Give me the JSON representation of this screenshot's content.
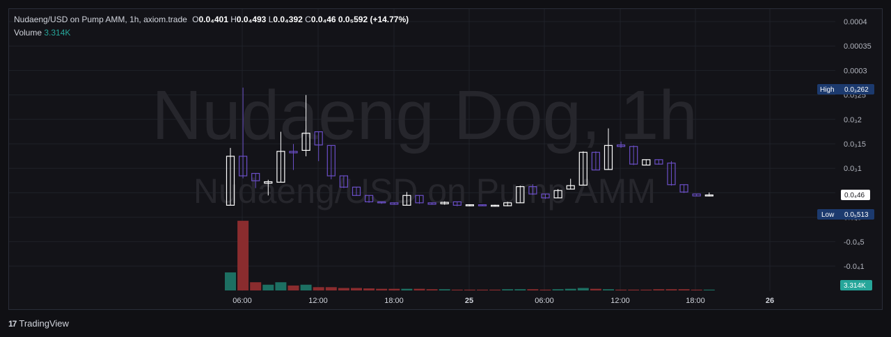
{
  "legend": {
    "pair": "Nudaeng/USD on Pump AMM, 1h, axiom.trade",
    "o_label": "O",
    "o_value": "0.0₄401",
    "h_label": "H",
    "h_value": "0.0₄493",
    "l_label": "L",
    "l_value": "0.0₄392",
    "c_label": "C",
    "c_value": "0.0₄46",
    "change": "0.0₅592 (+14.77%)"
  },
  "volume_legend": {
    "label": "Volume",
    "value": "3.314K"
  },
  "watermark": {
    "line1": "Nudaeng Dog, 1h",
    "line2": "Nudaeng/USD on Pump AMM"
  },
  "price_axis_labels": [
    "0.0004",
    "0.00035",
    "0.0003",
    "0.0₃25",
    "0.0₃2",
    "0.0₃15",
    "0.0₃1",
    "0.0₄5",
    "0.0₄5",
    "-0.0₄5",
    "-0.0₄1"
  ],
  "time_axis_labels": [
    "06:00",
    "12:00",
    "18:00",
    "25",
    "06:00",
    "12:00",
    "18:00",
    "26"
  ],
  "price_markers": {
    "high_label": "High",
    "high_value": "0.0₃262",
    "current_value": "0.0₄46",
    "low_label": "Low",
    "low_value": "0.0₅513"
  },
  "volume_marker": "3.314K",
  "footer": {
    "brand": "TradingView",
    "logo": "17"
  },
  "colors": {
    "background": "#131318",
    "grid": "#1f2229",
    "bull": "#ffffff",
    "bear": "#6b4fc8",
    "vol_up": "#1d6f62",
    "vol_down": "#8a2c2e",
    "high_badge": "#1c3a6e",
    "watermark": "#2a2a30"
  },
  "chart_data": {
    "type": "candlestick",
    "price_axis": {
      "min": -1.3e-05,
      "max": 4e-05,
      "unit": "USD"
    },
    "x_axis_ticks": [
      "06:00",
      "12:00",
      "18:00",
      "25",
      "06:00",
      "12:00",
      "18:00",
      "26"
    ],
    "candles": [
      {
        "o": 2.5e-06,
        "h": 1.42e-05,
        "l": 2.5e-06,
        "c": 1.25e-05
      },
      {
        "o": 1.25e-05,
        "h": 2.65e-05,
        "l": 8e-06,
        "c": 8.5e-06
      },
      {
        "o": 9e-06,
        "h": 9e-06,
        "l": 6e-06,
        "c": 7.5e-06
      },
      {
        "o": 7e-06,
        "h": 7.7e-06,
        "l": 4.5e-06,
        "c": 7.3e-06
      },
      {
        "o": 7.2e-06,
        "h": 1.75e-05,
        "l": 7.2e-06,
        "c": 1.35e-05
      },
      {
        "o": 1.35e-05,
        "h": 1.5e-05,
        "l": 9.7e-06,
        "c": 1.32e-05
      },
      {
        "o": 1.37e-05,
        "h": 2.5e-05,
        "l": 1.25e-05,
        "c": 1.72e-05
      },
      {
        "o": 1.75e-05,
        "h": 1.75e-05,
        "l": 1.15e-05,
        "c": 1.48e-05
      },
      {
        "o": 1.47e-05,
        "h": 1.47e-05,
        "l": 7.8e-06,
        "c": 8.5e-06
      },
      {
        "o": 8.5e-06,
        "h": 8.5e-06,
        "l": 6e-06,
        "c": 6.2e-06
      },
      {
        "o": 6.2e-06,
        "h": 6.2e-06,
        "l": 4.4e-06,
        "c": 4.5e-06
      },
      {
        "o": 4.5e-06,
        "h": 4.5e-06,
        "l": 3e-06,
        "c": 3.2e-06
      },
      {
        "o": 3.2e-06,
        "h": 3.2e-06,
        "l": 2.8e-06,
        "c": 3e-06
      },
      {
        "o": 3e-06,
        "h": 3e-06,
        "l": 2.6e-06,
        "c": 2.7e-06
      },
      {
        "o": 2.5e-06,
        "h": 5.2e-06,
        "l": 2.5e-06,
        "c": 4.5e-06
      },
      {
        "o": 4.5e-06,
        "h": 4.5e-06,
        "l": 2.8e-06,
        "c": 3e-06
      },
      {
        "o": 3e-06,
        "h": 3e-06,
        "l": 2.6e-06,
        "c": 2.7e-06
      },
      {
        "o": 2.8e-06,
        "h": 3.3e-06,
        "l": 2.6e-06,
        "c": 3.1e-06
      },
      {
        "o": 3.2e-06,
        "h": 3.2e-06,
        "l": 2.3e-06,
        "c": 2.5e-06
      },
      {
        "o": 2.5e-06,
        "h": 2.7e-06,
        "l": 2.3e-06,
        "c": 2.6e-06
      },
      {
        "o": 2.6e-06,
        "h": 2.6e-06,
        "l": 2.4e-06,
        "c": 2.5e-06
      },
      {
        "o": 2.5e-06,
        "h": 2.6e-06,
        "l": 2.3e-06,
        "c": 2.5e-06
      },
      {
        "o": 2.4e-06,
        "h": 3.2e-06,
        "l": 2.3e-06,
        "c": 3e-06
      },
      {
        "o": 3e-06,
        "h": 6.5e-06,
        "l": 3e-06,
        "c": 6.3e-06
      },
      {
        "o": 6.3e-06,
        "h": 6.8e-06,
        "l": 4.6e-06,
        "c": 4.8e-06
      },
      {
        "o": 4.8e-06,
        "h": 4.8e-06,
        "l": 3.8e-06,
        "c": 4e-06
      },
      {
        "o": 4e-06,
        "h": 5.8e-06,
        "l": 4e-06,
        "c": 5.5e-06
      },
      {
        "o": 5.8e-06,
        "h": 7.9e-06,
        "l": 5.8e-06,
        "c": 6.5e-06
      },
      {
        "o": 6.6e-06,
        "h": 1.35e-05,
        "l": 6.6e-06,
        "c": 1.33e-05
      },
      {
        "o": 1.33e-05,
        "h": 1.35e-05,
        "l": 9.8e-06,
        "c": 9.7e-06
      },
      {
        "o": 9.8e-06,
        "h": 1.82e-05,
        "l": 9.8e-06,
        "c": 1.47e-05
      },
      {
        "o": 1.48e-05,
        "h": 1.55e-05,
        "l": 1.42e-05,
        "c": 1.45e-05
      },
      {
        "o": 1.45e-05,
        "h": 1.47e-05,
        "l": 1.07e-05,
        "c": 1.09e-05
      },
      {
        "o": 1.07e-05,
        "h": 1.18e-05,
        "l": 1.07e-05,
        "c": 1.18e-05
      },
      {
        "o": 1.18e-05,
        "h": 1.18e-05,
        "l": 1.08e-05,
        "c": 1.09e-05
      },
      {
        "o": 1.11e-05,
        "h": 1.15e-05,
        "l": 6.5e-06,
        "c": 6.7e-06
      },
      {
        "o": 6.7e-06,
        "h": 6.7e-06,
        "l": 5e-06,
        "c": 5.2e-06
      },
      {
        "o": 4.8e-06,
        "h": 4.8e-06,
        "l": 4.3e-06,
        "c": 4.4e-06
      },
      {
        "o": 4.4e-06,
        "h": 5.1e-06,
        "l": 4.3e-06,
        "c": 4.6e-06
      }
    ],
    "volume": [
      {
        "v": 0.22,
        "up": true
      },
      {
        "v": 0.85,
        "up": false
      },
      {
        "v": 0.1,
        "up": false
      },
      {
        "v": 0.07,
        "up": true
      },
      {
        "v": 0.1,
        "up": true
      },
      {
        "v": 0.06,
        "up": false
      },
      {
        "v": 0.07,
        "up": true
      },
      {
        "v": 0.04,
        "up": false
      },
      {
        "v": 0.04,
        "up": false
      },
      {
        "v": 0.03,
        "up": false
      },
      {
        "v": 0.03,
        "up": false
      },
      {
        "v": 0.025,
        "up": false
      },
      {
        "v": 0.02,
        "up": false
      },
      {
        "v": 0.02,
        "up": false
      },
      {
        "v": 0.02,
        "up": true
      },
      {
        "v": 0.02,
        "up": false
      },
      {
        "v": 0.015,
        "up": false
      },
      {
        "v": 0.015,
        "up": true
      },
      {
        "v": 0.01,
        "up": false
      },
      {
        "v": 0.01,
        "up": false
      },
      {
        "v": 0.01,
        "up": false
      },
      {
        "v": 0.01,
        "up": false
      },
      {
        "v": 0.015,
        "up": true
      },
      {
        "v": 0.015,
        "up": true
      },
      {
        "v": 0.015,
        "up": false
      },
      {
        "v": 0.01,
        "up": false
      },
      {
        "v": 0.015,
        "up": true
      },
      {
        "v": 0.02,
        "up": true
      },
      {
        "v": 0.03,
        "up": true
      },
      {
        "v": 0.02,
        "up": false
      },
      {
        "v": 0.015,
        "up": true
      },
      {
        "v": 0.01,
        "up": false
      },
      {
        "v": 0.01,
        "up": false
      },
      {
        "v": 0.01,
        "up": false
      },
      {
        "v": 0.015,
        "up": false
      },
      {
        "v": 0.015,
        "up": false
      },
      {
        "v": 0.015,
        "up": false
      },
      {
        "v": 0.01,
        "up": false
      },
      {
        "v": 0.01,
        "up": true
      }
    ]
  }
}
